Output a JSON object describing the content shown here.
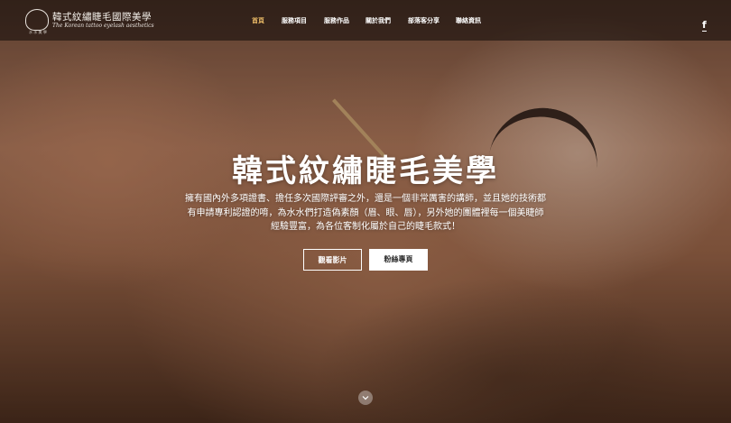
{
  "brand": {
    "title": "韓式紋繡睫毛國際美學",
    "subtitle": "The Korean tattoo eyelash aesthetics",
    "tag": "水 水 美 學"
  },
  "nav": {
    "items": [
      {
        "label": "首頁",
        "active": true
      },
      {
        "label": "服務項目",
        "active": false
      },
      {
        "label": "服務作品",
        "active": false
      },
      {
        "label": "關於我們",
        "active": false
      },
      {
        "label": "部落客分享",
        "active": false
      },
      {
        "label": "聯絡資訊",
        "active": false
      }
    ],
    "active_color": "#e7b765"
  },
  "social": {
    "facebook_label": "f",
    "icon": "facebook-icon"
  },
  "hero": {
    "title": "韓式紋繡睫毛美學",
    "description": "擁有國內外多項證書、擔任多次國際評審之外，還是一個非常厲害的講師，並且她的技術都有申請專利認證的唷，為水水們打造偽素顏（眉、眼、唇），另外她的團體裡每一個美睫師經驗豐富，為各位客制化屬於自己的睫毛款式！",
    "buttons": {
      "video": "觀看影片",
      "fanpage": "粉絲專頁"
    }
  },
  "scroll": {
    "icon": "chevron-down-icon"
  }
}
